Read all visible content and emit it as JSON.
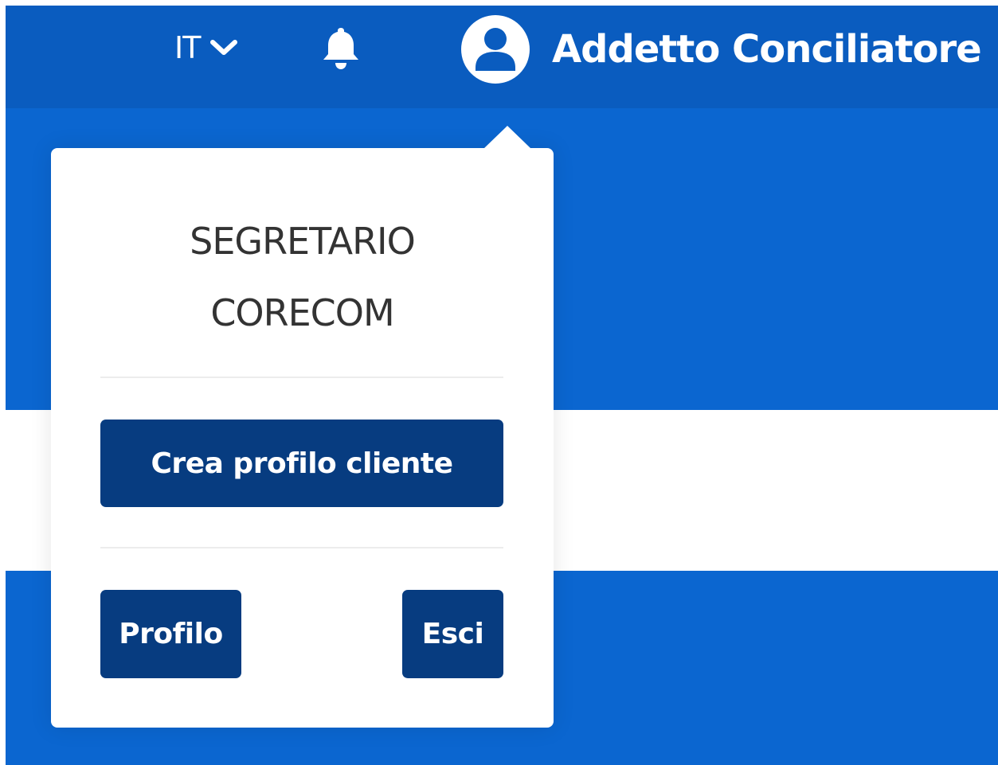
{
  "header": {
    "language": "IT",
    "user_name": "Addetto Conciliatore",
    "icons": {
      "language_chevron": "chevron-down-icon",
      "notifications": "bell-icon",
      "user": "user-avatar-icon"
    }
  },
  "dropdown": {
    "role_line1": "SEGRETARIO",
    "role_line2": "CORECOM",
    "create_client_profile_label": "Crea profilo cliente",
    "profile_label": "Profilo",
    "logout_label": "Esci"
  },
  "colors": {
    "header_bg": "#0a5cbf",
    "page_bg": "#0b66d0",
    "button_bg": "#073c80",
    "text_dark": "#333333"
  }
}
